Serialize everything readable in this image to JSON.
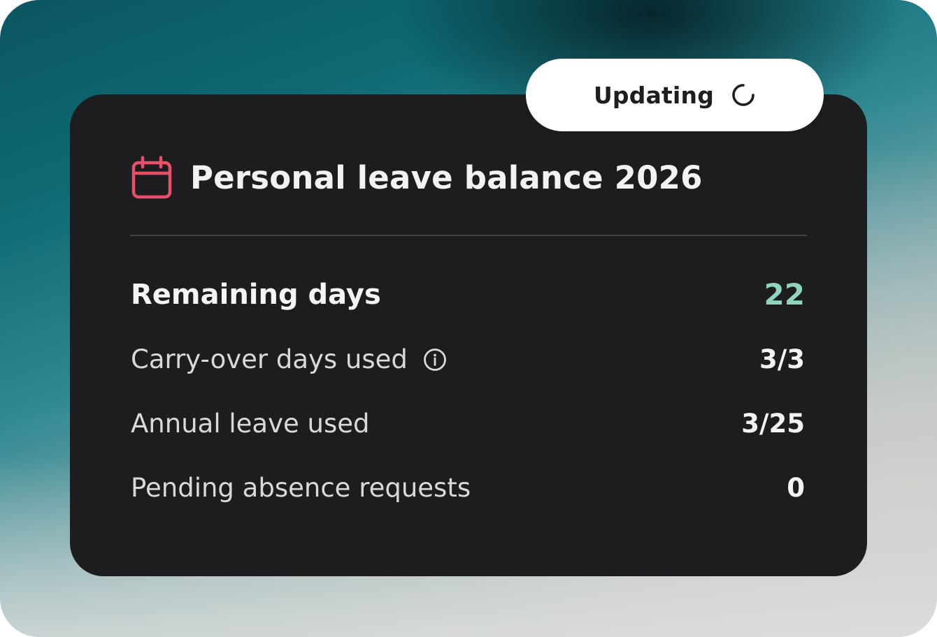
{
  "status_pill": {
    "label": "Updating",
    "icon": "spinner-icon"
  },
  "card": {
    "icon": "calendar-icon",
    "title": "Personal leave balance 2026",
    "rows": [
      {
        "label": "Remaining days",
        "value": "22",
        "emphasis": true
      },
      {
        "label": "Carry-over days used",
        "value": "3/3",
        "has_info_icon": true
      },
      {
        "label": "Annual leave used",
        "value": "3/25"
      },
      {
        "label": "Pending absence requests",
        "value": "0"
      }
    ]
  },
  "colors": {
    "card_background": "#1d1d1f",
    "accent_icon": "#e8506a",
    "remaining_value": "#8fd4c1",
    "pill_background": "#ffffff"
  }
}
